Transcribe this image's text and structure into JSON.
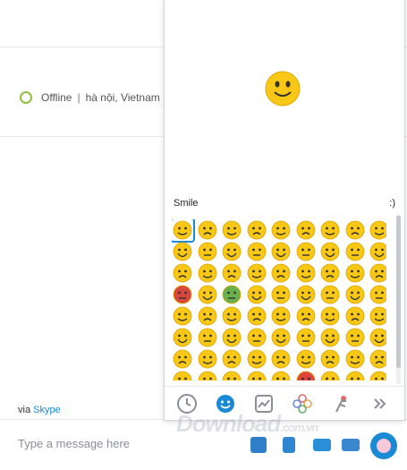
{
  "status": {
    "state": "Offline",
    "separator": "|",
    "location": "hà nội, Vietnam",
    "status_color": "#8fbf3f"
  },
  "via": {
    "prefix": "via",
    "link": "Skype"
  },
  "composer": {
    "placeholder": "Type a message here"
  },
  "emoticons": {
    "preview_name": "Smile",
    "preview_shortcut": ":)",
    "grid_rows": 8,
    "grid_cols": 9,
    "tabs": [
      "recent-icon",
      "smiley-icon",
      "trending-icon",
      "flower-icon",
      "sports-icon",
      "more-icon"
    ]
  },
  "watermark": {
    "text": "Download",
    "suffix": ".com.vn"
  },
  "colors": {
    "accent": "#1a8ad4",
    "emoji_face": "#f9c816"
  }
}
